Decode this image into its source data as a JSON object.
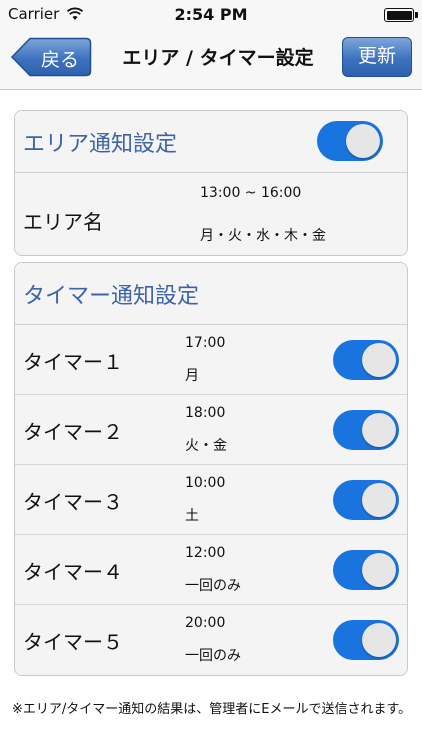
{
  "status_bar": {
    "carrier": "Carrier",
    "time": "2:54 PM"
  },
  "nav": {
    "back_label": "戻る",
    "title": "エリア / タイマー設定",
    "update_label": "更新"
  },
  "area_section": {
    "title": "エリア通知設定",
    "enabled": true,
    "row": {
      "label": "エリア名",
      "time": "13:00 ~ 16:00",
      "days": "月・火・水・木・金"
    }
  },
  "timer_section": {
    "title": "タイマー通知設定",
    "timers": [
      {
        "label": "タイマー１",
        "time": "17:00",
        "days": "月",
        "enabled": true
      },
      {
        "label": "タイマー２",
        "time": "18:00",
        "days": "火・金",
        "enabled": true
      },
      {
        "label": "タイマー３",
        "time": "10:00",
        "days": "土",
        "enabled": true
      },
      {
        "label": "タイマー４",
        "time": "12:00",
        "days": "一回のみ",
        "enabled": true
      },
      {
        "label": "タイマー５",
        "time": "20:00",
        "days": "一回のみ",
        "enabled": true
      }
    ]
  },
  "footnote": "※エリア/タイマー通知の結果は、管理者にEメールで送信されます。",
  "colors": {
    "accent_blue": "#3c64a6",
    "toggle_on": "#1a74e0",
    "nav_button": "#3d72be"
  },
  "icons": {
    "wifi": "wifi-icon",
    "battery": "battery-icon",
    "back_chevron": "back-arrow-icon"
  }
}
